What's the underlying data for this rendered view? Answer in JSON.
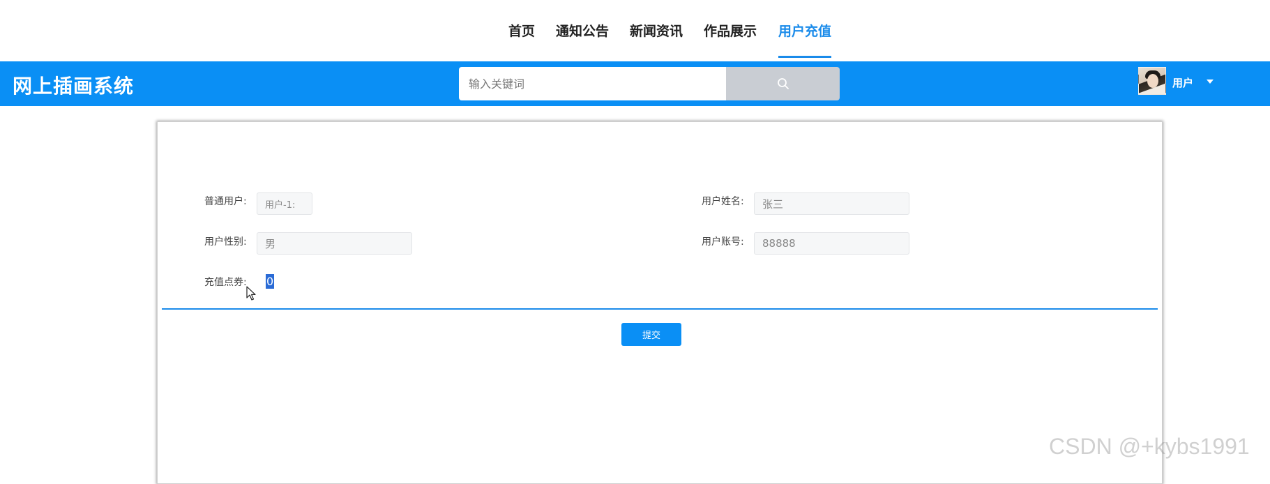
{
  "nav": {
    "items": [
      {
        "label": "首页"
      },
      {
        "label": "通知公告"
      },
      {
        "label": "新闻资讯"
      },
      {
        "label": "作品展示"
      },
      {
        "label": "用户充值",
        "active": true
      }
    ],
    "active_color": "#1a8bea"
  },
  "header": {
    "title": "网上插画系统",
    "search_placeholder": "输入关键词",
    "search_icon": "search-icon",
    "user_label": "用户",
    "caret_icon": "caret-down-icon",
    "bar_color": "#0a8ff5"
  },
  "form": {
    "normal_user_label": "普通用户:",
    "normal_user_value": "用户-1:",
    "user_name_label": "用户姓名:",
    "user_name_value": "张三",
    "gender_label": "用户性别:",
    "gender_value": "男",
    "account_label": "用户账号:",
    "account_value": "88888",
    "recharge_label": "充值点券:",
    "recharge_value": "0",
    "submit_label": "提交"
  },
  "watermark": "CSDN @+kybs1991"
}
